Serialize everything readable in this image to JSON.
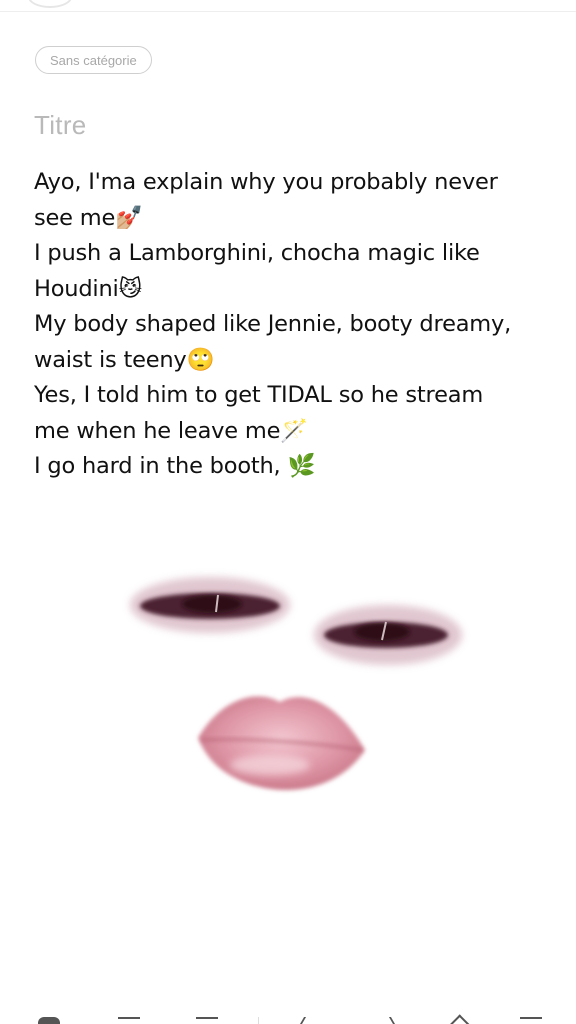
{
  "header": {
    "category_chip": "Sans catégorie",
    "title_placeholder": "Titre"
  },
  "note": {
    "lines": [
      "Ayo, I'ma explain why you probably never",
      "see me💅🏼",
      "I push a Lamborghini, chocha magic like",
      "Houdini😼",
      "My body shaped like Jennie, booty dreamy,",
      "waist is teeny🙄",
      "Yes, I told him to get TIDAL so he stream",
      "me when he leave me🪄",
      "I go hard in the booth, 🌿"
    ]
  },
  "image": {
    "subject": "eyes-and-lips-face-art",
    "colors": {
      "eye": "#5a2a35",
      "eye_shadow": "#c8a2b0",
      "lips": "#d88c9c",
      "lips_light": "#f3c8d0"
    }
  },
  "toolbar": {
    "icons": [
      "checkbox-icon",
      "bullet-list-icon",
      "numbered-list-icon",
      "undo-icon",
      "redo-icon",
      "text-format-icon",
      "more-menu-icon"
    ]
  }
}
